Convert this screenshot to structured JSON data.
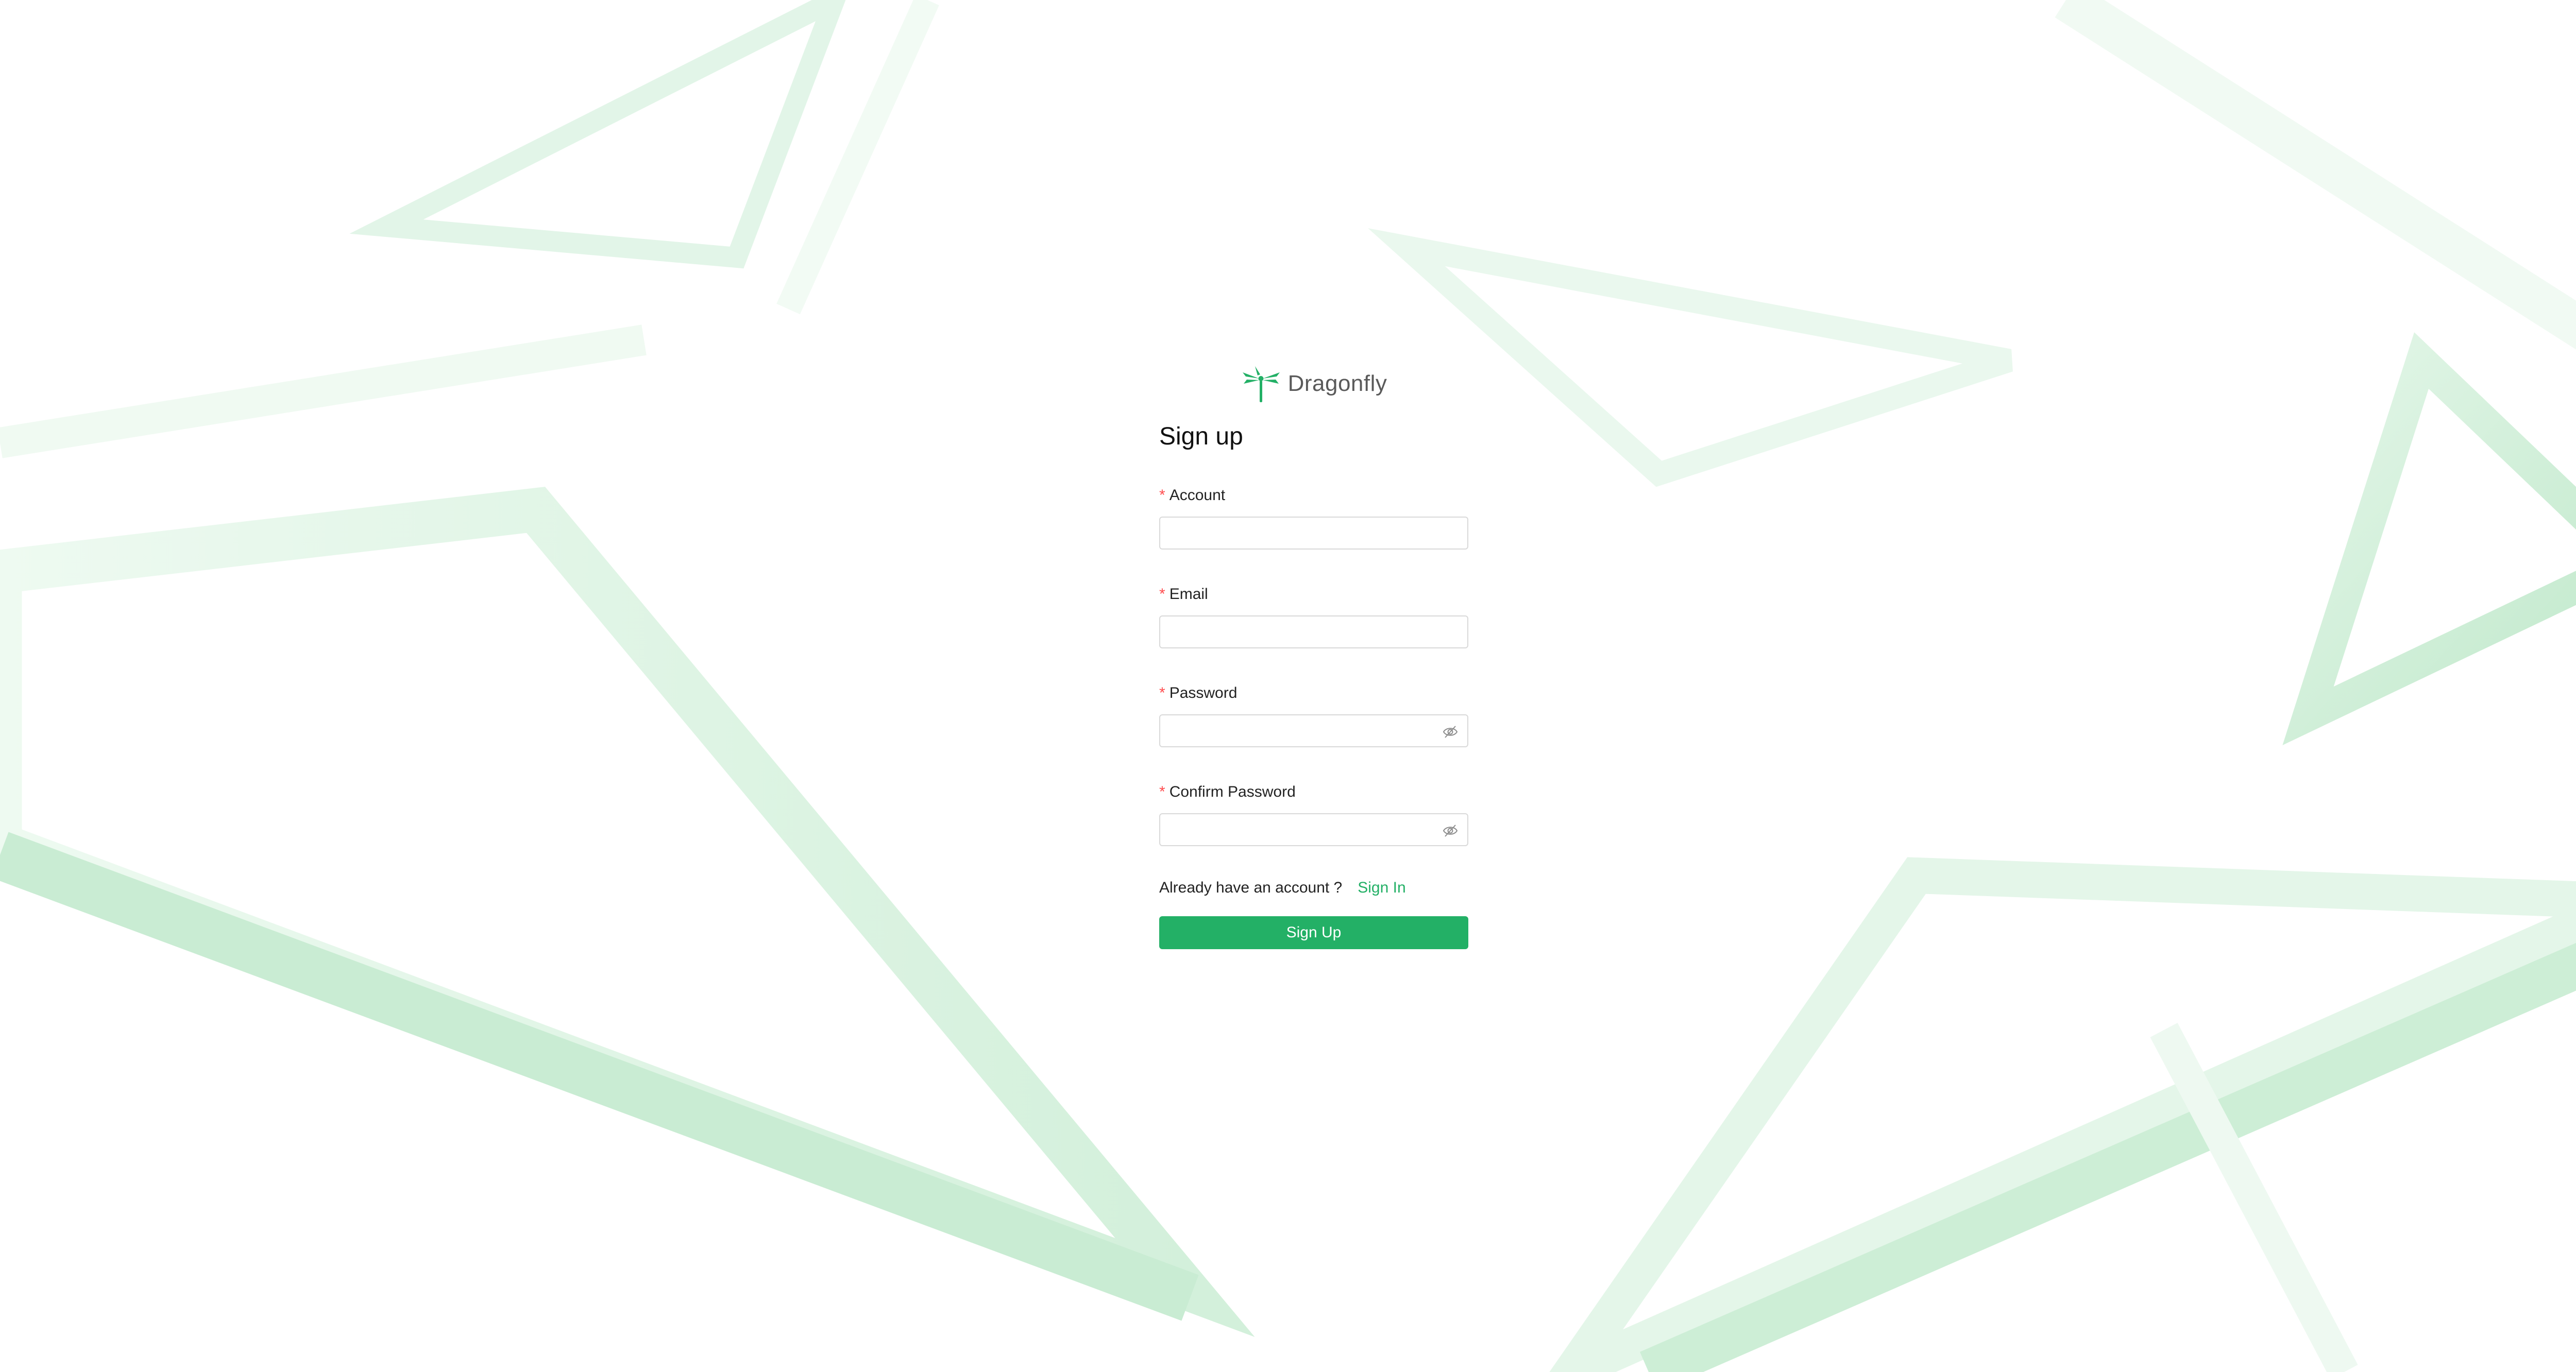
{
  "app": {
    "logo_icon": "dragonfly-icon",
    "name": "Dragonfly"
  },
  "page": {
    "title": "Sign up"
  },
  "form": {
    "required_mark": "*",
    "account": {
      "label": "Account",
      "value": "",
      "placeholder": ""
    },
    "email": {
      "label": "Email",
      "value": "",
      "placeholder": ""
    },
    "password": {
      "label": "Password",
      "value": "",
      "placeholder": "",
      "toggle_icon": "eye-invisible-icon"
    },
    "confirm_password": {
      "label": "Confirm Password",
      "value": "",
      "placeholder": "",
      "toggle_icon": "eye-invisible-icon"
    },
    "already_text": "Already have an account ?",
    "sign_in_link": "Sign In",
    "submit_label": "Sign Up"
  },
  "colors": {
    "accent": "#23b066",
    "required": "#ff4d4f",
    "background_shapes": "#c8ecd2"
  }
}
